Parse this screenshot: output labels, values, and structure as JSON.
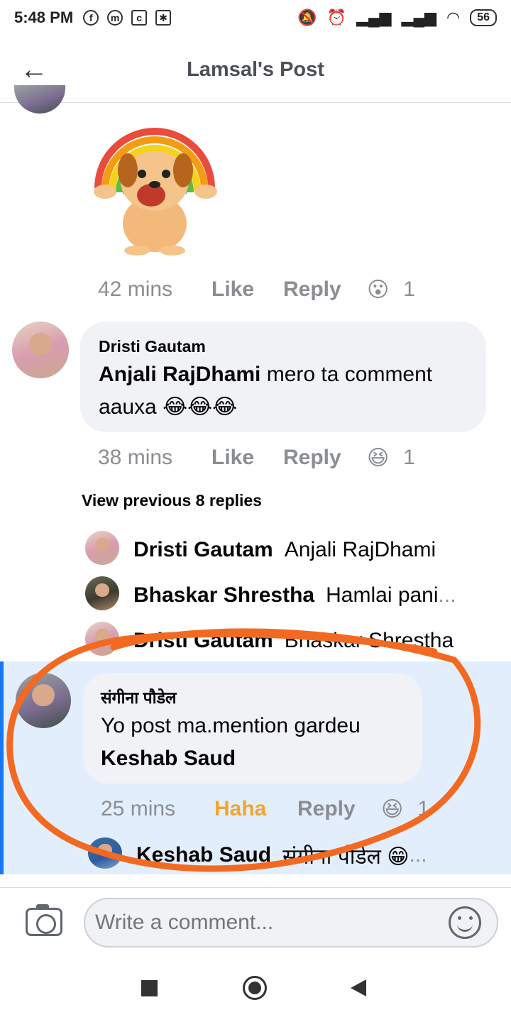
{
  "status_bar": {
    "time": "5:48 PM",
    "battery": "56",
    "left_icons": [
      "facebook-icon",
      "messenger-icon",
      "app-icon",
      "app-icon"
    ],
    "right_icons": [
      "mute-icon",
      "alarm-icon",
      "signal-icon",
      "signal-icon",
      "wifi-icon"
    ]
  },
  "header": {
    "title": "Lamsal's Post",
    "back_icon": "arrow-left-icon"
  },
  "comment1": {
    "time": "42 mins",
    "like": "Like",
    "reply": "Reply",
    "reaction_emoji": "😮",
    "reaction_count": "1"
  },
  "comment2": {
    "author": "Dristi Gautam",
    "mention": "Anjali RajDhami",
    "text_line1": " mero ta comment",
    "text_line2": "aauxa 😂😂😂",
    "time": "38 mins",
    "like": "Like",
    "reply": "Reply",
    "reaction_emoji": "😆",
    "reaction_count": "1"
  },
  "view_previous": "View previous 8 replies",
  "replies": [
    {
      "name": "Dristi Gautam",
      "text": "Anjali RajDhami",
      "ellipsis": ""
    },
    {
      "name": "Bhaskar Shrestha",
      "text": "Hamlai pani",
      "ellipsis": "..."
    },
    {
      "name": "Dristi Gautam",
      "text": "Bhaskar Shrestha",
      "ellipsis": ""
    }
  ],
  "comment3": {
    "author": "संगीना पौडेल",
    "text": "Yo post ma.mention gardeu",
    "mention": "Keshab Saud",
    "time": "25 mins",
    "haha": "Haha",
    "reply": "Reply",
    "reaction_emoji": "😆",
    "reaction_count": "1"
  },
  "sub_reply": {
    "name": "Keshab Saud",
    "text": "संगीना पौडेल 😁",
    "ellipsis": "..."
  },
  "composer": {
    "placeholder": "Write a comment...",
    "camera_icon": "camera-icon",
    "emoji_icon": "smiley-icon"
  },
  "colors": {
    "highlight_bg": "#e3eefc",
    "haha": "#f0a530",
    "annotation": "#f26a21",
    "meta_gray": "#8a8d91"
  }
}
